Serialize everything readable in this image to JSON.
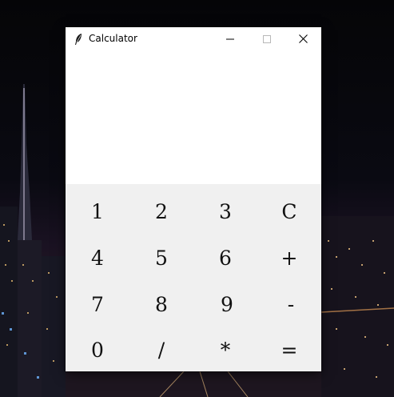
{
  "window": {
    "title": "Calculator",
    "controls": {
      "minimize": "minimize-icon",
      "maximize": "maximize-icon",
      "close": "close-icon"
    }
  },
  "display": {
    "value": ""
  },
  "keypad": {
    "rows": [
      [
        "1",
        "2",
        "3",
        "C"
      ],
      [
        "4",
        "5",
        "6",
        "+"
      ],
      [
        "7",
        "8",
        "9",
        "-"
      ],
      [
        "0",
        "/",
        "*",
        "="
      ]
    ]
  },
  "colors": {
    "window_bg": "#ffffff",
    "keypad_bg": "#f0f0f0",
    "key_text": "#111111"
  }
}
